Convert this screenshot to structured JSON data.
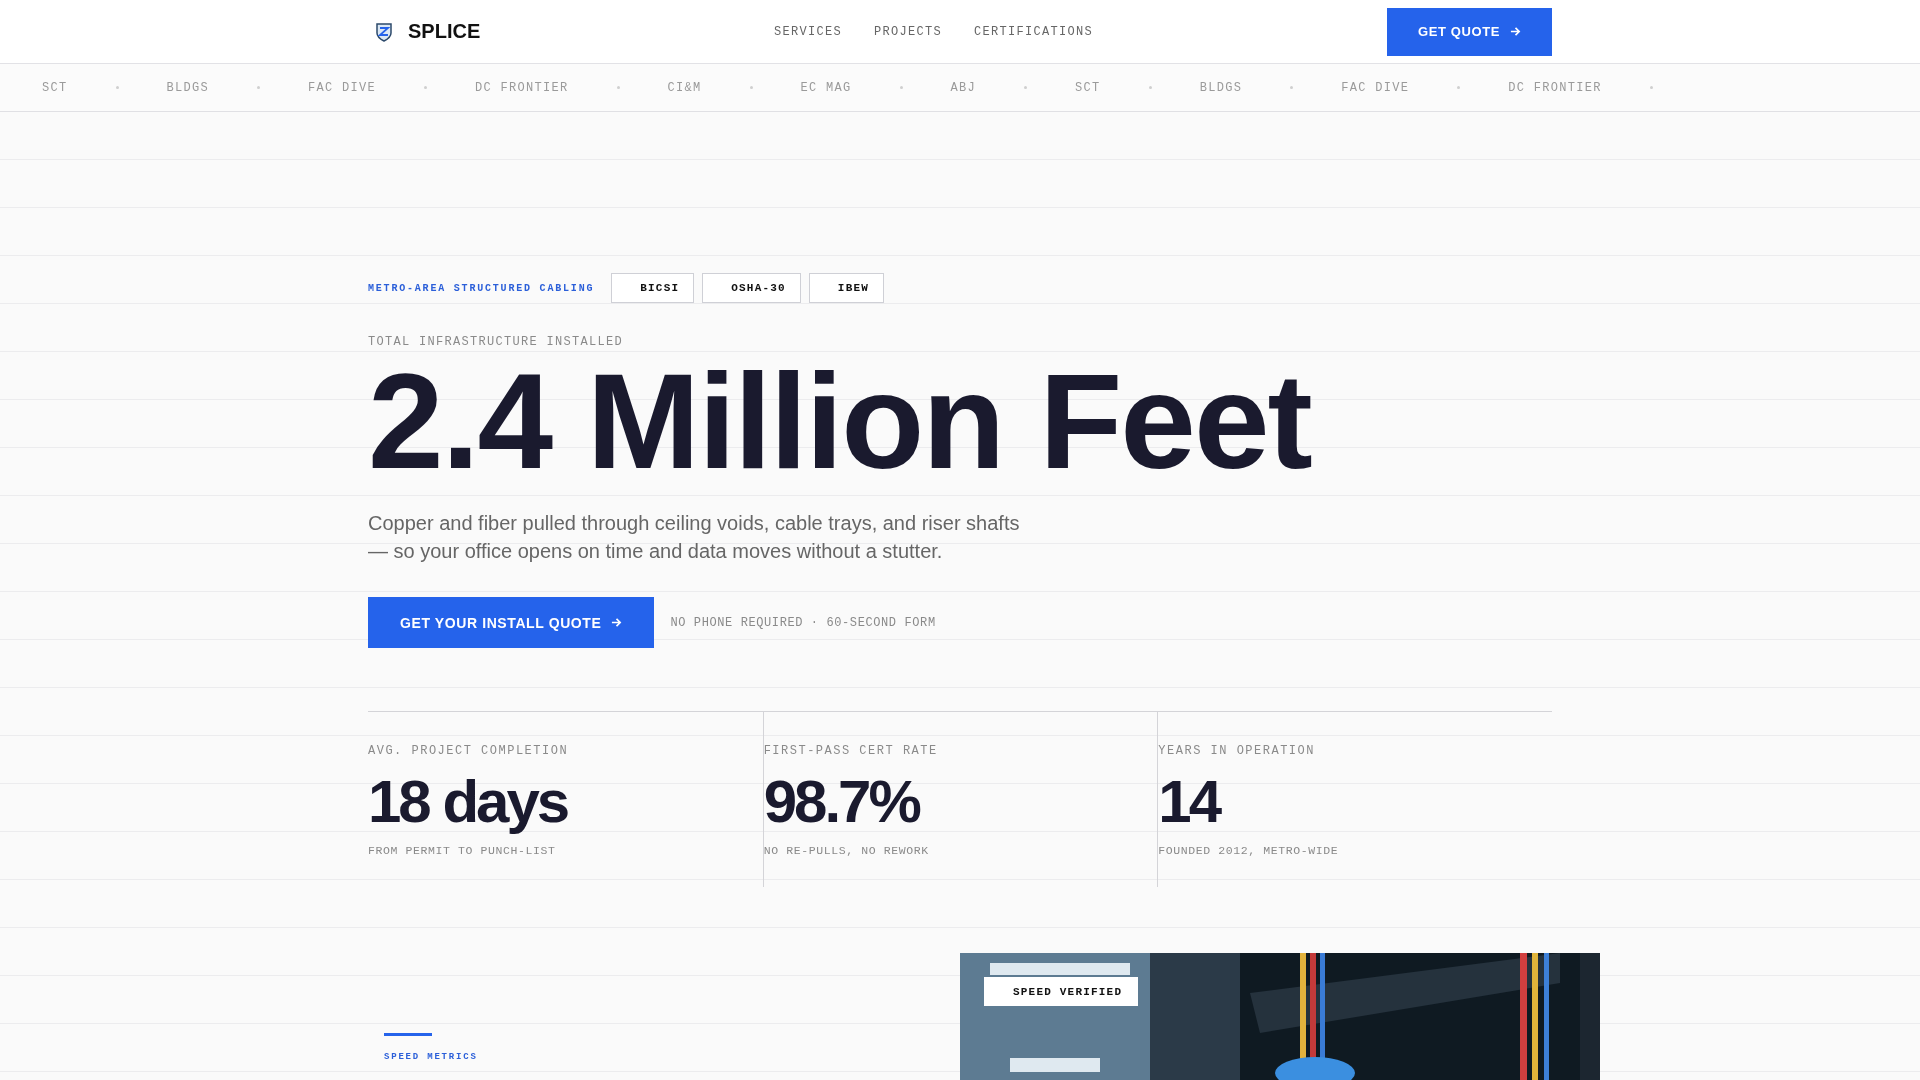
{
  "header": {
    "brand": "SPLICE",
    "nav": [
      {
        "label": "SERVICES"
      },
      {
        "label": "PROJECTS"
      },
      {
        "label": "CERTIFICATIONS"
      }
    ],
    "cta": "GET QUOTE"
  },
  "ticker": [
    "SCT",
    "BLDGS",
    "FAC DIVE",
    "DC FRONTIER",
    "CI&M",
    "EC MAG",
    "ABJ",
    "SCT",
    "BLDGS",
    "FAC DIVE",
    "DC FRONTIER"
  ],
  "hero": {
    "eyebrow": "METRO-AREA STRUCTURED CABLING",
    "badges": [
      "BICSI",
      "OSHA-30",
      "IBEW"
    ],
    "kicker": "TOTAL INFRASTRUCTURE INSTALLED",
    "headline": "2.4 Million Feet",
    "lede": "Copper and fiber pulled through ceiling voids, cable trays, and riser shafts — so your office opens on time and data moves without a stutter.",
    "cta": "GET YOUR INSTALL QUOTE",
    "note": "NO PHONE REQUIRED · 60-SECOND FORM"
  },
  "stats": [
    {
      "label": "AVG. PROJECT COMPLETION",
      "value": "18 days",
      "sub": "FROM PERMIT TO PUNCH-LIST"
    },
    {
      "label": "FIRST-PASS CERT RATE",
      "value": "98.7%",
      "sub": "NO RE-PULLS, NO REWORK"
    },
    {
      "label": "YEARS IN OPERATION",
      "value": "14",
      "sub": "FOUNDED 2012, METRO-WIDE"
    }
  ],
  "feature": {
    "eyebrow": "SPEED METRICS",
    "photo": {
      "kind": "picture",
      "tag": "SPEED VERIFIED"
    }
  }
}
